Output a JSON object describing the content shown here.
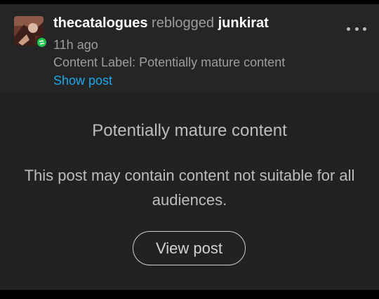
{
  "post": {
    "blog_name": "thecatalogues",
    "action": "reblogged",
    "source_blog": "junkirat",
    "timestamp": "11h ago",
    "content_label": "Content Label: Potentially mature content",
    "show_post_label": "Show post",
    "avatar_icon": "blog-avatar",
    "badge_icon": "reblog-icon",
    "menu_icon": "more-options-icon"
  },
  "warning": {
    "title": "Potentially mature content",
    "body": "This post may contain content not suitable for all audiences.",
    "button_label": "View post"
  },
  "colors": {
    "page_background": "#000000",
    "card_background": "#222222",
    "header_background": "#252525",
    "link": "#1ea8ec",
    "reblog_badge": "#25c24f",
    "muted_text": "#9d9d9d"
  }
}
